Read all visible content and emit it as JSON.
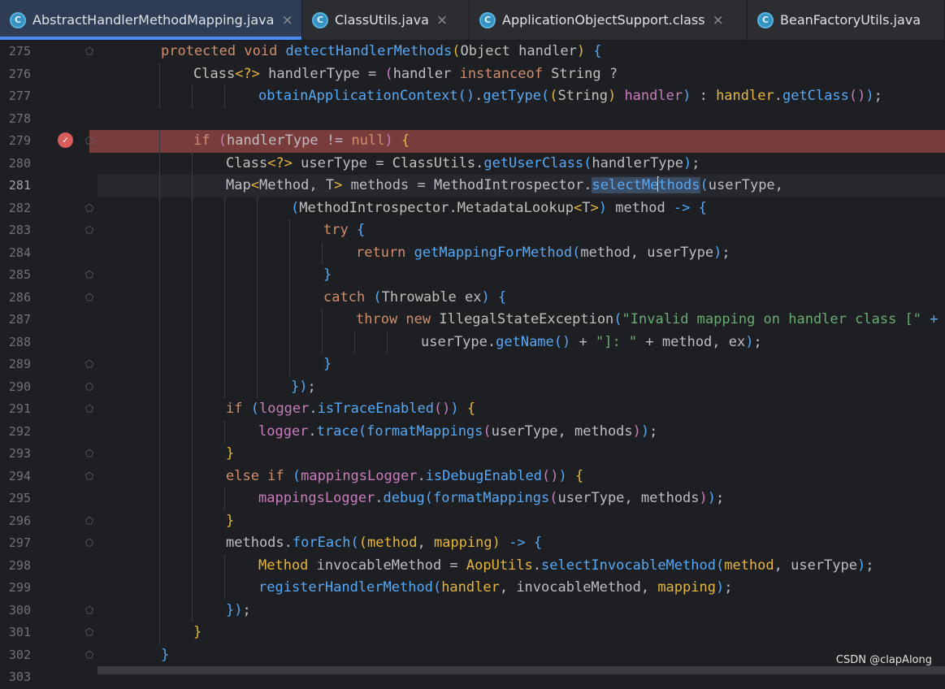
{
  "tabs": [
    {
      "label": "AbstractHandlerMethodMapping.java",
      "active": true,
      "icon": "class-icon",
      "icon_letter": "C"
    },
    {
      "label": "ClassUtils.java",
      "active": false,
      "icon": "class-icon",
      "icon_letter": "C"
    },
    {
      "label": "ApplicationObjectSupport.class",
      "active": false,
      "icon": "class-icon",
      "icon_letter": "C"
    },
    {
      "label": "BeanFactoryUtils.java",
      "active": false,
      "icon": "class-icon",
      "icon_letter": "C"
    }
  ],
  "close_glyph": "×",
  "lines": [
    {
      "n": "275",
      "indent": 1,
      "fold": true,
      "tokens": [
        [
          "kw",
          "protected "
        ],
        [
          "kw",
          "void "
        ],
        [
          "fn",
          "detectHandlerMethods"
        ],
        [
          "pr1",
          "("
        ],
        [
          "cls",
          "Object "
        ],
        [
          "prm",
          "handler"
        ],
        [
          "pr1",
          ")"
        ],
        [
          "",
          ""
        ],
        [
          "",
          ""
        ],
        [
          "pr3",
          " {"
        ]
      ]
    },
    {
      "n": "276",
      "indent": 2,
      "fold": false,
      "tokens": [
        [
          "cls",
          "Class"
        ],
        [
          "pr1",
          "<?>"
        ],
        [
          "",
          " handlerType = "
        ],
        [
          "pr2",
          "("
        ],
        [
          "",
          "handler "
        ],
        [
          "kw",
          "instanceof "
        ],
        [
          "cls",
          "String "
        ],
        [
          "",
          "?"
        ]
      ]
    },
    {
      "n": "277",
      "indent": 4,
      "fold": false,
      "tokens": [
        [
          "fn",
          "obtainApplicationContext"
        ],
        [
          "pr3",
          "()"
        ],
        [
          "",
          "."
        ],
        [
          "fn",
          "getType"
        ],
        [
          "pr3",
          "("
        ],
        [
          "pr1",
          "("
        ],
        [
          "cls",
          "String"
        ],
        [
          "pr1",
          ")"
        ],
        [
          "pr2",
          " handler"
        ],
        [
          "pr3",
          ")"
        ],
        [
          "",
          " : "
        ],
        [
          "pr1",
          "handler"
        ],
        [
          "",
          "."
        ],
        [
          "fn",
          "getClass"
        ],
        [
          "pr2",
          "()"
        ],
        [
          "pr3",
          ")"
        ],
        [
          "",
          ";"
        ]
      ]
    },
    {
      "n": "278",
      "indent": 0,
      "fold": false,
      "tokens": []
    },
    {
      "n": "279",
      "indent": 2,
      "fold": true,
      "bp": true,
      "tokens": [
        [
          "kw",
          "if "
        ],
        [
          "pr2",
          "("
        ],
        [
          "",
          "handlerType != "
        ],
        [
          "kw",
          "null"
        ],
        [
          "pr2",
          ")"
        ],
        [
          "pr1",
          " {"
        ]
      ]
    },
    {
      "n": "280",
      "indent": 3,
      "fold": false,
      "tokens": [
        [
          "cls",
          "Class"
        ],
        [
          "pr1",
          "<?>"
        ],
        [
          "",
          " userType = "
        ],
        [
          "cls",
          "ClassUtils"
        ],
        [
          "",
          "."
        ],
        [
          "fn",
          "getUserClass"
        ],
        [
          "pr3",
          "("
        ],
        [
          "",
          "handlerType"
        ],
        [
          "pr3",
          ")"
        ],
        [
          "",
          ";"
        ]
      ]
    },
    {
      "n": "281",
      "indent": 3,
      "fold": false,
      "cur": true,
      "tokens": [
        [
          "cls",
          "Map"
        ],
        [
          "pr1",
          "<"
        ],
        [
          "cls",
          "Method"
        ],
        [
          "",
          ", "
        ],
        [
          "cls",
          "T"
        ],
        [
          "pr1",
          ">"
        ],
        [
          "",
          " methods = "
        ],
        [
          "cls",
          "MethodIntrospector"
        ],
        [
          "",
          "."
        ],
        [
          "sel",
          "selectMe"
        ],
        [
          "caret",
          ""
        ],
        [
          "sel",
          "thods"
        ],
        [
          "pr3",
          "("
        ],
        [
          "",
          "userType,"
        ]
      ]
    },
    {
      "n": "282",
      "indent": 5,
      "fold": true,
      "tokens": [
        [
          "pr3",
          "("
        ],
        [
          "cls",
          "MethodIntrospector"
        ],
        [
          "",
          "."
        ],
        [
          "cls",
          "MetadataLookup"
        ],
        [
          "pr1",
          "<"
        ],
        [
          "cls",
          "T"
        ],
        [
          "pr1",
          ">"
        ],
        [
          "pr3",
          ")"
        ],
        [
          "",
          " method "
        ],
        [
          "pr3",
          "-> {"
        ]
      ]
    },
    {
      "n": "283",
      "indent": 6,
      "fold": true,
      "tokens": [
        [
          "kw",
          "try "
        ],
        [
          "pr3",
          "{"
        ]
      ]
    },
    {
      "n": "284",
      "indent": 7,
      "fold": false,
      "tokens": [
        [
          "kw",
          "return "
        ],
        [
          "fn",
          "getMappingForMethod"
        ],
        [
          "pr3",
          "("
        ],
        [
          "",
          "method, userType"
        ],
        [
          "pr3",
          ")"
        ],
        [
          "",
          ";"
        ]
      ]
    },
    {
      "n": "285",
      "indent": 6,
      "fold": true,
      "tokens": [
        [
          "pr3",
          "}"
        ]
      ]
    },
    {
      "n": "286",
      "indent": 6,
      "fold": true,
      "tokens": [
        [
          "kw",
          "catch "
        ],
        [
          "pr3",
          "("
        ],
        [
          "cls",
          "Throwable "
        ],
        [
          "",
          "ex"
        ],
        [
          "pr3",
          ")"
        ],
        [
          "pr3",
          " {"
        ]
      ]
    },
    {
      "n": "287",
      "indent": 7,
      "fold": false,
      "tokens": [
        [
          "kw",
          "throw new "
        ],
        [
          "cls",
          "IllegalStateException"
        ],
        [
          "pr3",
          "("
        ],
        [
          "str",
          "\"Invalid mapping on handler class [\""
        ],
        [
          "pr3",
          " +"
        ]
      ]
    },
    {
      "n": "288",
      "indent": 9,
      "fold": false,
      "tokens": [
        [
          "",
          "userType."
        ],
        [
          "fn",
          "getName"
        ],
        [
          "pr3",
          "()"
        ],
        [
          "",
          " + "
        ],
        [
          "str",
          "\"]: \""
        ],
        [
          "",
          " + method, ex"
        ],
        [
          "pr3",
          ")"
        ],
        [
          "",
          ";"
        ]
      ]
    },
    {
      "n": "289",
      "indent": 6,
      "fold": true,
      "tokens": [
        [
          "pr3",
          "}"
        ]
      ]
    },
    {
      "n": "290",
      "indent": 5,
      "fold": true,
      "tokens": [
        [
          "pr3",
          "})"
        ],
        [
          "",
          ";"
        ]
      ]
    },
    {
      "n": "291",
      "indent": 3,
      "fold": true,
      "tokens": [
        [
          "kw",
          "if "
        ],
        [
          "pr3",
          "("
        ],
        [
          "fld",
          "logger"
        ],
        [
          "",
          "."
        ],
        [
          "fn",
          "isTraceEnabled"
        ],
        [
          "pr2",
          "()"
        ],
        [
          "pr3",
          ")"
        ],
        [
          "pr1",
          " {"
        ]
      ]
    },
    {
      "n": "292",
      "indent": 4,
      "fold": false,
      "tokens": [
        [
          "fld",
          "logger"
        ],
        [
          "",
          "."
        ],
        [
          "fn",
          "trace"
        ],
        [
          "pr3",
          "("
        ],
        [
          "fn",
          "formatMappings"
        ],
        [
          "pr2",
          "("
        ],
        [
          "",
          "userType, methods"
        ],
        [
          "pr2",
          ")"
        ],
        [
          "pr3",
          ")"
        ],
        [
          "",
          ";"
        ]
      ]
    },
    {
      "n": "293",
      "indent": 3,
      "fold": true,
      "tokens": [
        [
          "pr1",
          "}"
        ]
      ]
    },
    {
      "n": "294",
      "indent": 3,
      "fold": true,
      "tokens": [
        [
          "kw",
          "else if "
        ],
        [
          "pr3",
          "("
        ],
        [
          "fld",
          "mappingsLogger"
        ],
        [
          "",
          "."
        ],
        [
          "fn",
          "isDebugEnabled"
        ],
        [
          "pr2",
          "()"
        ],
        [
          "pr3",
          ")"
        ],
        [
          "pr1",
          " {"
        ]
      ]
    },
    {
      "n": "295",
      "indent": 4,
      "fold": false,
      "tokens": [
        [
          "fld",
          "mappingsLogger"
        ],
        [
          "",
          "."
        ],
        [
          "fn",
          "debug"
        ],
        [
          "pr3",
          "("
        ],
        [
          "fn",
          "formatMappings"
        ],
        [
          "pr2",
          "("
        ],
        [
          "",
          "userType, methods"
        ],
        [
          "pr2",
          ")"
        ],
        [
          "pr3",
          ")"
        ],
        [
          "",
          ";"
        ]
      ]
    },
    {
      "n": "296",
      "indent": 3,
      "fold": true,
      "tokens": [
        [
          "pr1",
          "}"
        ]
      ]
    },
    {
      "n": "297",
      "indent": 3,
      "fold": true,
      "tokens": [
        [
          "",
          "methods."
        ],
        [
          "fn",
          "forEach"
        ],
        [
          "pr3",
          "("
        ],
        [
          "pr1",
          "("
        ],
        [
          "pr1",
          "method"
        ],
        [
          "",
          ", "
        ],
        [
          "pr1",
          "mapping"
        ],
        [
          "pr1",
          ")"
        ],
        [
          "",
          " "
        ],
        [
          "pr3",
          "-> {"
        ]
      ]
    },
    {
      "n": "298",
      "indent": 4,
      "fold": false,
      "tokens": [
        [
          "pr1",
          "Method "
        ],
        [
          "",
          "invocableMethod = "
        ],
        [
          "pr1",
          "AopUtils"
        ],
        [
          "",
          "."
        ],
        [
          "fn",
          "selectInvocableMethod"
        ],
        [
          "pr3",
          "("
        ],
        [
          "pr1",
          "method"
        ],
        [
          "",
          ", userType"
        ],
        [
          "pr3",
          ")"
        ],
        [
          "",
          ";"
        ]
      ]
    },
    {
      "n": "299",
      "indent": 4,
      "fold": false,
      "tokens": [
        [
          "fn",
          "registerHandlerMethod"
        ],
        [
          "pr3",
          "("
        ],
        [
          "pr1",
          "handler"
        ],
        [
          "",
          ", invocableMethod, "
        ],
        [
          "pr1",
          "mapping"
        ],
        [
          "pr3",
          ")"
        ],
        [
          "",
          ";"
        ]
      ]
    },
    {
      "n": "300",
      "indent": 3,
      "fold": true,
      "tokens": [
        [
          "pr3",
          "})"
        ],
        [
          "",
          ";"
        ]
      ]
    },
    {
      "n": "301",
      "indent": 2,
      "fold": true,
      "tokens": [
        [
          "pr1",
          "}"
        ]
      ]
    },
    {
      "n": "302",
      "indent": 1,
      "fold": true,
      "tokens": [
        [
          "pr3",
          "}"
        ]
      ]
    },
    {
      "n": "303",
      "indent": 0,
      "fold": false,
      "tokens": []
    }
  ],
  "watermark": "CSDN @clapAlong",
  "icons": {
    "breakpoint": "breakpoint-check-icon",
    "fold": "fold-marker-icon"
  }
}
